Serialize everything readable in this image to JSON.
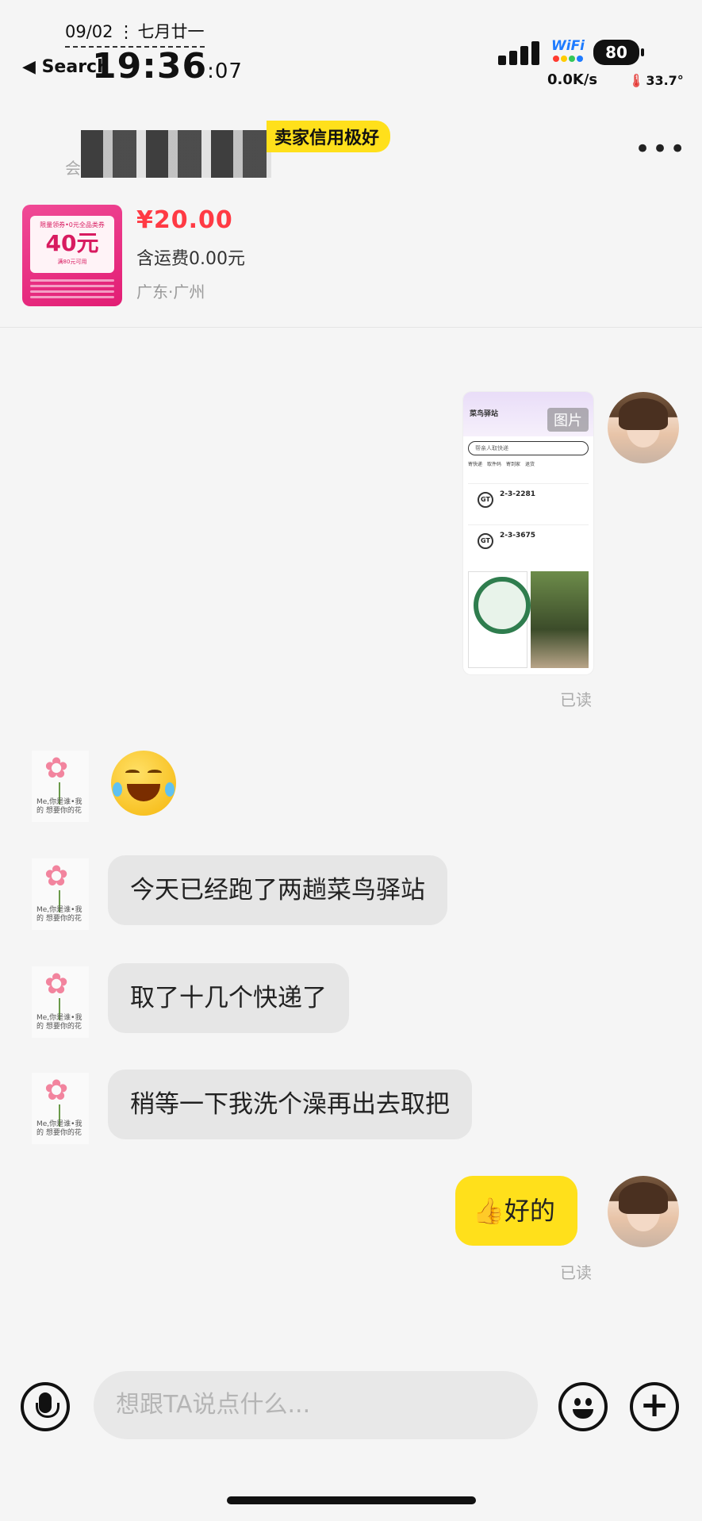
{
  "status_bar": {
    "date": "09/02",
    "lunar": "七月廿一",
    "back_label": "◀ Search",
    "time": "19:36",
    "seconds": ":07",
    "wifi_label": "WiFi",
    "battery": "80",
    "net_speed": "0.0K/s",
    "temperature": "33.7°"
  },
  "header": {
    "credit_badge": "卖家信用极好",
    "seller_sub": "会",
    "more_label": "•••"
  },
  "product": {
    "thumb_coupon_top": "限量领券•0元全品类券",
    "thumb_amount": "40元",
    "thumb_coupon_bottom": "满80元可用",
    "price": "¥20.00",
    "shipping": "含运费0.00元",
    "location": "广东·广州"
  },
  "messages": {
    "image_label": "图片",
    "image_app_title": "菜鸟驿站",
    "image_search_placeholder": "帮亲人取快递",
    "image_tabs": [
      "寄快递",
      "取件码",
      "寄到家",
      "退货"
    ],
    "image_codes": [
      "2-3-2281",
      "2-3-3675"
    ],
    "read_label_1": "已读",
    "m1": "今天已经跑了两趟菜鸟驿站",
    "m2": "取了十几个快递了",
    "m3": "稍等一下我洗个澡再出去取把",
    "my_reply": "好的",
    "my_reply_emoji": "👍",
    "read_label_2": "已读",
    "avatar_scribble": "Me,你是谁•我的 想要你的花"
  },
  "input_bar": {
    "placeholder": "想跟TA说点什么..."
  },
  "colors": {
    "accent_yellow": "#ffe01b",
    "price_red": "#ff3a44",
    "bubble_gray": "#e6e6e6"
  }
}
